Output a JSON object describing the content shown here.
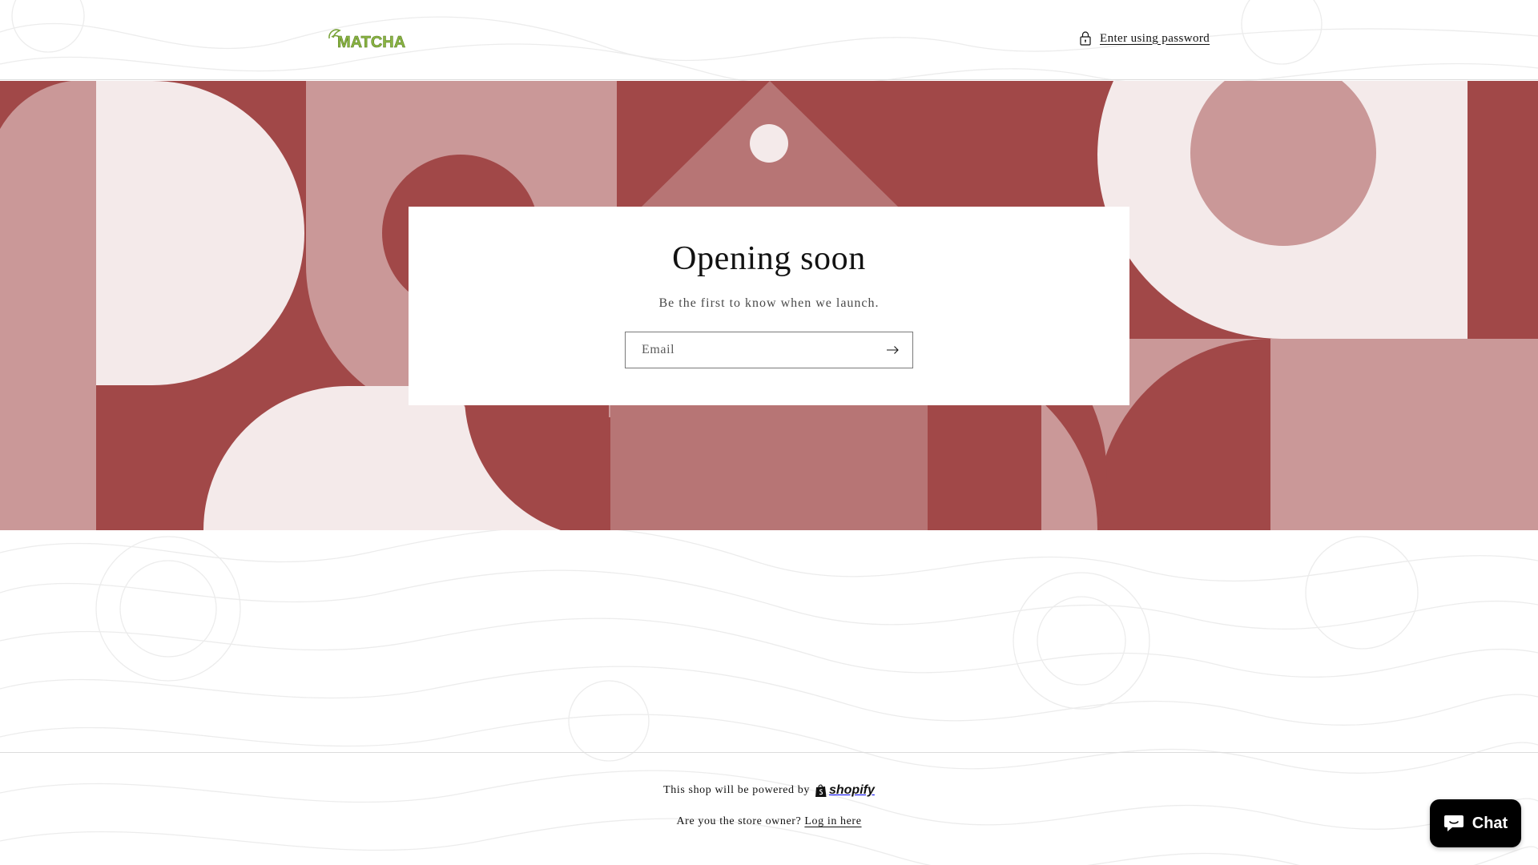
{
  "colors": {
    "banner_dark": "#a14848",
    "banner_mid": "#b77575",
    "banner_light": "#ca9898",
    "banner_pale": "#f4eaea",
    "logo_green": "#8ab543",
    "chat_bg": "#000000"
  },
  "header": {
    "logo_text": "MATCHA",
    "logo_icon": "matcha-leaf-logo",
    "password_link_icon": "lock-icon",
    "password_link_label": "Enter using password"
  },
  "newsletter": {
    "title": "Opening soon",
    "subtitle": "Be the first to know when we launch.",
    "email_placeholder": "Email",
    "email_value": "",
    "submit_icon": "arrow-right-icon"
  },
  "footer": {
    "powered_text": "This shop will be powered by",
    "shopify_wordmark": "shopify",
    "owner_question": "Are you the store owner?",
    "login_link": "Log in here"
  },
  "chat": {
    "icon": "chat-bubble-icon",
    "label": "Chat"
  }
}
